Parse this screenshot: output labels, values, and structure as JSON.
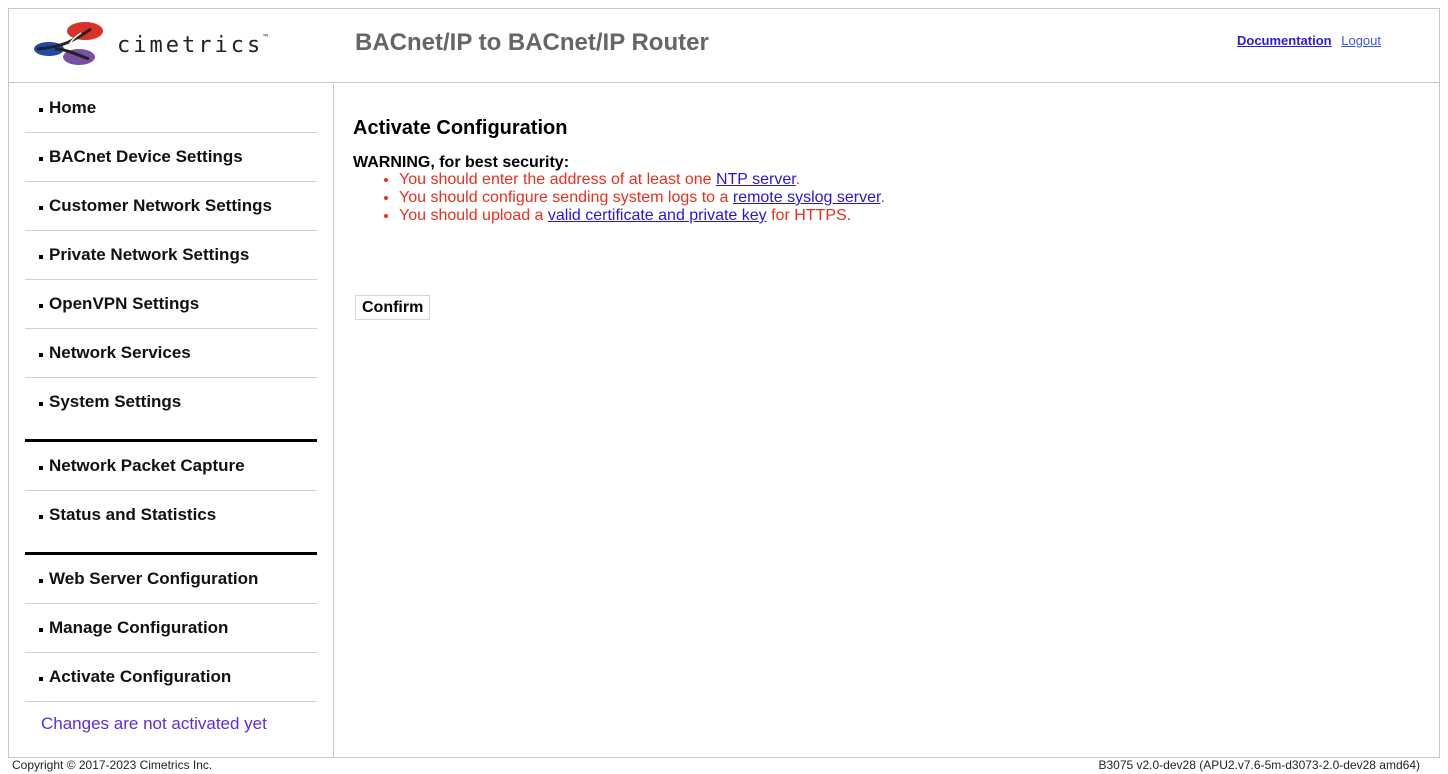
{
  "header": {
    "logo_text": "cimetrics",
    "logo_tm": "™",
    "app_title": "BACnet/IP to BACnet/IP Router",
    "documentation_link": "Documentation",
    "logout_link": "Logout"
  },
  "sidebar": {
    "items": [
      {
        "label": "Home"
      },
      {
        "label": "BACnet Device Settings"
      },
      {
        "label": "Customer Network Settings"
      },
      {
        "label": "Private Network Settings"
      },
      {
        "label": "OpenVPN Settings"
      },
      {
        "label": "Network Services"
      },
      {
        "label": "System Settings"
      },
      {
        "label": "Network Packet Capture"
      },
      {
        "label": "Status and Statistics"
      },
      {
        "label": "Web Server Configuration"
      },
      {
        "label": "Manage Configuration"
      },
      {
        "label": "Activate Configuration"
      }
    ],
    "note": "Changes are not activated yet"
  },
  "main": {
    "title": "Activate Configuration",
    "warning_heading": "WARNING, for best security:",
    "warnings": [
      {
        "before": "You should enter the address of at least one ",
        "link": "NTP server",
        "after": "."
      },
      {
        "before": "You should configure sending system logs to a ",
        "link": "remote syslog server",
        "after": "."
      },
      {
        "before": "You should upload a ",
        "link": "valid certificate and private key",
        "after": " for HTTPS."
      }
    ],
    "confirm_label": "Confirm"
  },
  "footer": {
    "copyright": "Copyright © 2017-2023 Cimetrics Inc.",
    "version": "B3075 v2.0-dev28 (APU2.v7.6-5m-d3073-2.0-dev28 amd64)"
  },
  "colors": {
    "warning_text": "#e8301f",
    "link": "#2a16d4",
    "note": "#5b2be0",
    "title_gray": "#666666"
  },
  "icons": [
    "cimetrics-logo"
  ]
}
